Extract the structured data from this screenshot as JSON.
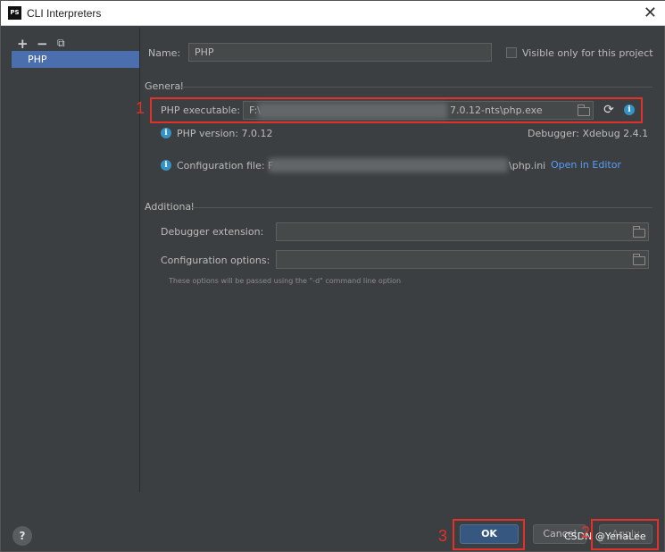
{
  "window": {
    "title": "CLI Interpreters",
    "app_icon": "PS"
  },
  "sidebar": {
    "add": "+",
    "remove": "−",
    "copy": "⧉",
    "items": [
      {
        "label": "PHP"
      }
    ]
  },
  "name_row": {
    "label": "Name:",
    "value": "PHP",
    "visible_only": "Visible only for this project"
  },
  "general": {
    "section": "General",
    "exec_label": "PHP executable:",
    "exec_prefix": "F:\\",
    "exec_suffix": "7.0.12-nts\\php.exe",
    "php_version": "PHP version: 7.0.12",
    "debugger": "Debugger: Xdebug 2.4.1",
    "config_label": "Configuration file: F",
    "config_suffix": "\\php.ini",
    "open_editor": "Open in Editor"
  },
  "additional": {
    "section": "Additional",
    "debugger_ext": "Debugger extension:",
    "config_opts": "Configuration options:",
    "hint": "These options will be passed using the \"-d\" command line option"
  },
  "buttons": {
    "ok": "OK",
    "cancel": "Cancel",
    "apply": "Apply",
    "help": "?"
  },
  "annotations": {
    "n1": "1",
    "n3": "3",
    "n2": "2"
  },
  "watermark": "CSDN @YeriaLee",
  "colors": {
    "highlight": "#e0322a",
    "selection": "#4b6eaf",
    "link": "#589df6",
    "info": "#3592c4"
  }
}
